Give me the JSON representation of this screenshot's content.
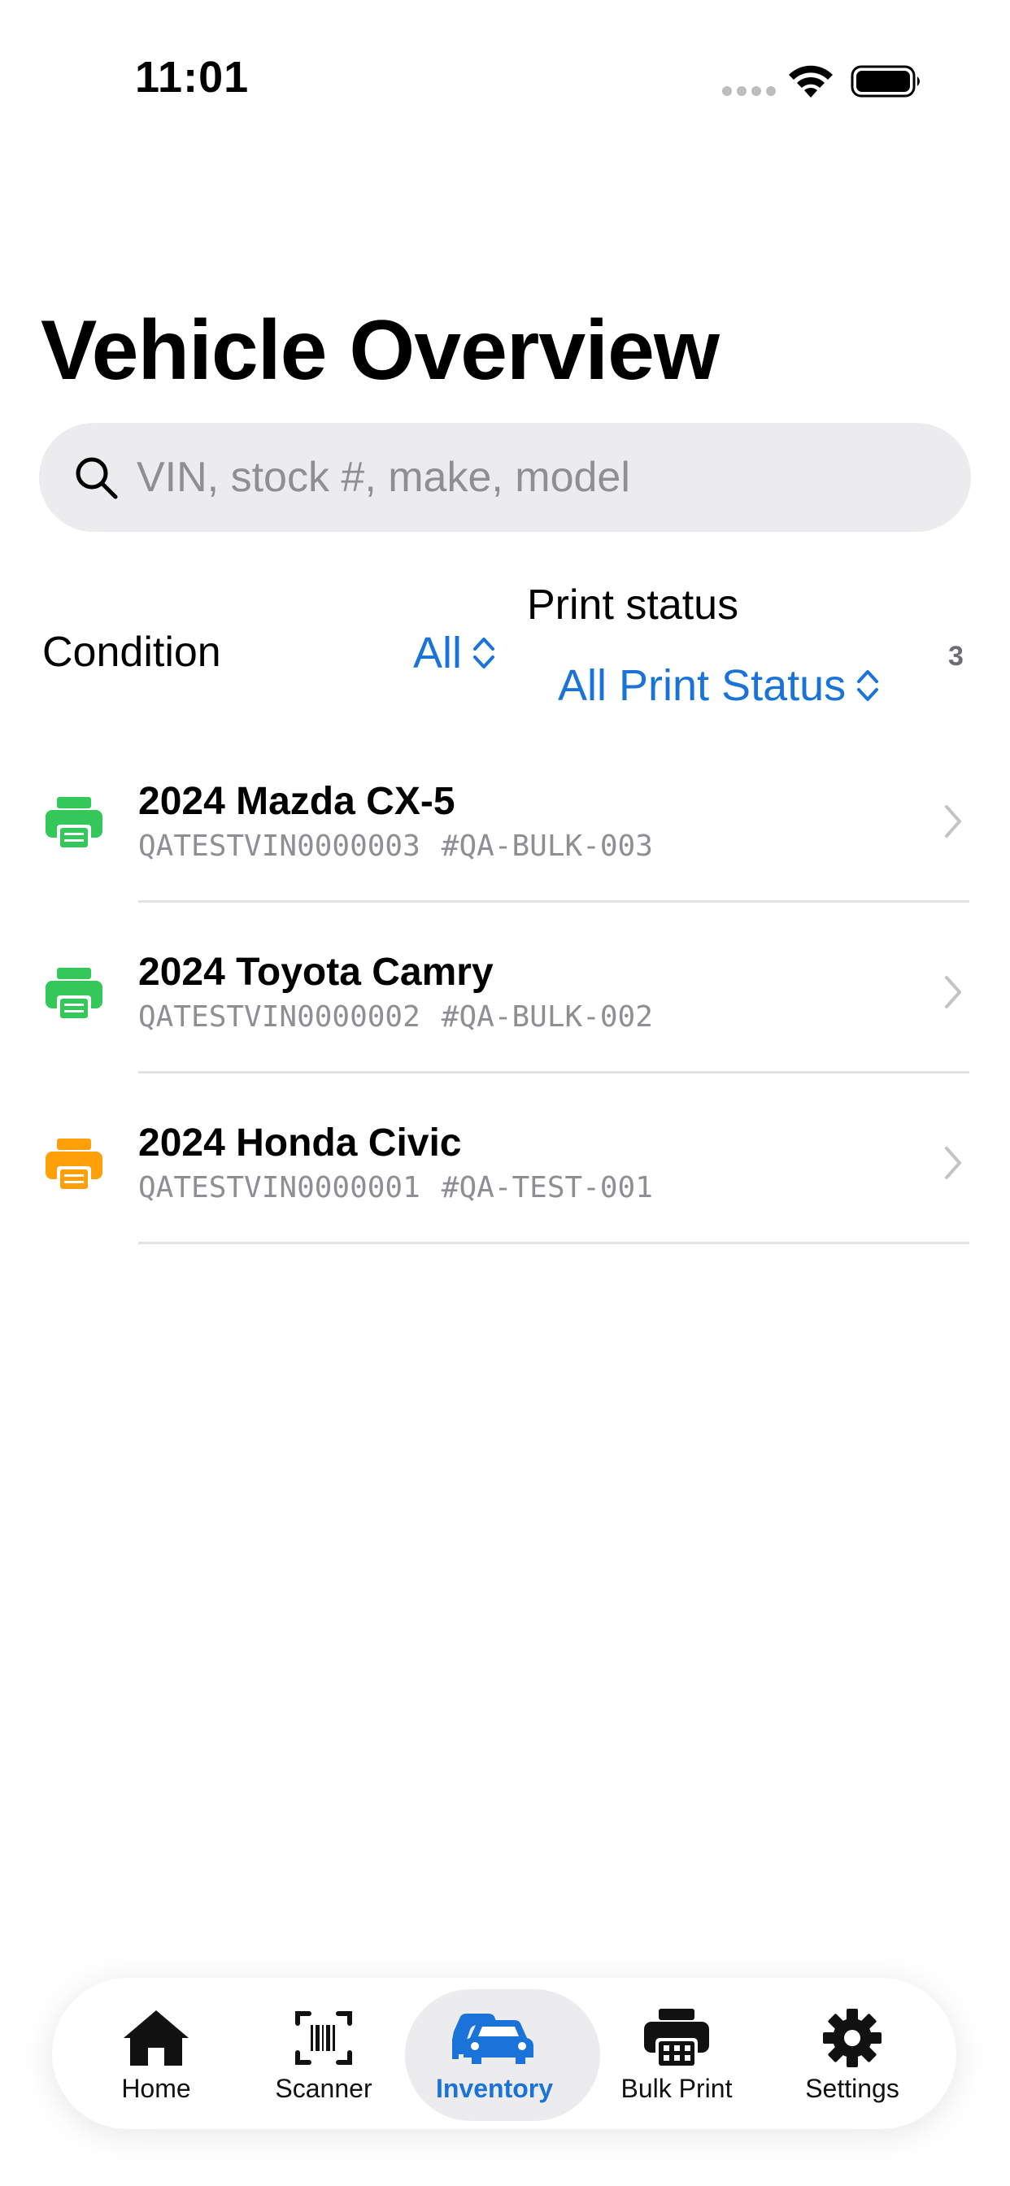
{
  "status_bar": {
    "time": "11:01"
  },
  "header": {
    "title": "Vehicle Overview"
  },
  "search": {
    "placeholder": "VIN, stock #, make, model"
  },
  "filters": {
    "condition_label": "Condition",
    "condition_value": "All",
    "print_status_label": "Print status",
    "print_status_value": "All Print Status",
    "result_count": "3"
  },
  "vehicles": [
    {
      "name": "2024 Mazda CX-5",
      "vin": "QATESTVIN0000003",
      "stock": "#QA-BULK-003",
      "print_status_color": "#34c759"
    },
    {
      "name": "2024 Toyota Camry",
      "vin": "QATESTVIN0000002",
      "stock": "#QA-BULK-002",
      "print_status_color": "#34c759"
    },
    {
      "name": "2024 Honda Civic",
      "vin": "QATESTVIN0000001",
      "stock": "#QA-TEST-001",
      "print_status_color": "#ff9f0a"
    }
  ],
  "tab_bar": {
    "active_color": "#1a73d9",
    "tabs": [
      {
        "label": "Home",
        "icon": "house-icon"
      },
      {
        "label": "Scanner",
        "icon": "barcode-scanner-icon"
      },
      {
        "label": "Inventory",
        "icon": "cars-icon",
        "active": true
      },
      {
        "label": "Bulk Print",
        "icon": "printer-icon"
      },
      {
        "label": "Settings",
        "icon": "gear-icon"
      }
    ]
  }
}
